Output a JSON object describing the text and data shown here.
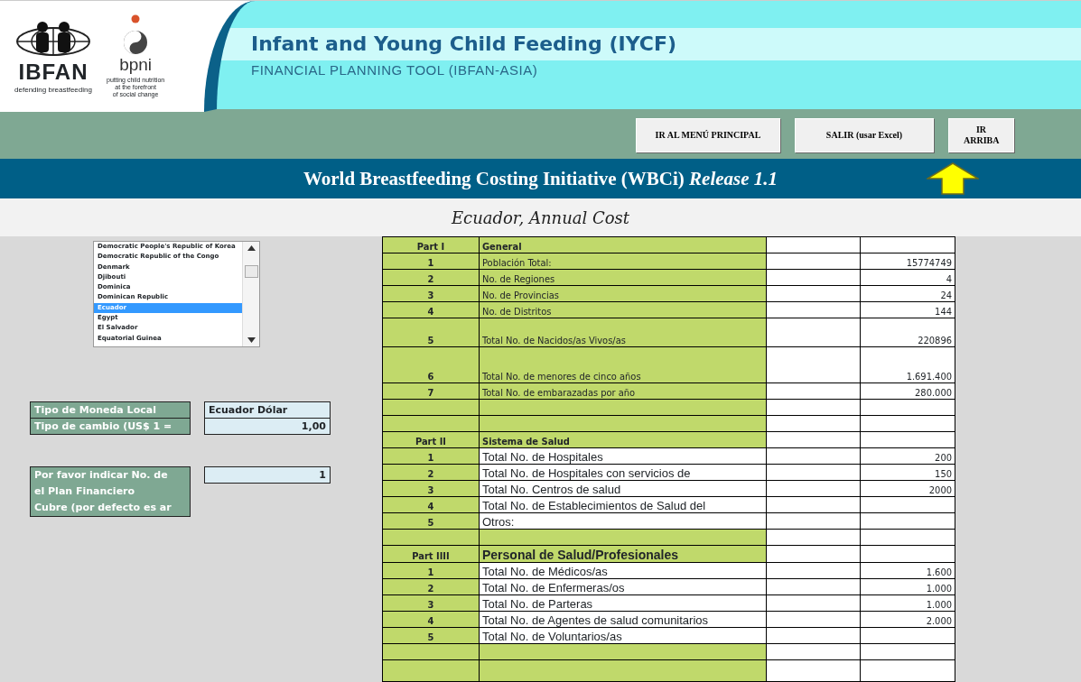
{
  "header": {
    "ibfan_logo": {
      "name": "IBFAN",
      "tagline": "defending breastfeeding"
    },
    "bpni_logo": {
      "name": "bpni",
      "tagline": [
        "putting child nutrition",
        "at the forefront",
        "of social change"
      ]
    },
    "title": "Infant and Young Child Feeding (IYCF)",
    "subtitle": "FINANCIAL PLANNING TOOL (IBFAN-ASIA)"
  },
  "buttons": [
    "IR AL MENÚ PRINCIPAL",
    "SALIR (usar Excel)",
    "IR ARRIBA"
  ],
  "banner": {
    "title": "World Breastfeeding Costing Initiative (WBCi) *Release 1.1*"
  },
  "subtitle": "Ecuador, Annual Cost",
  "country_list": [
    {
      "label": "Democratic People's Republic of Korea",
      "selected": false
    },
    {
      "label": "Democratic Republic of the Congo",
      "selected": false
    },
    {
      "label": "Denmark",
      "selected": false
    },
    {
      "label": "Djibouti",
      "selected": false
    },
    {
      "label": "Dominica",
      "selected": false
    },
    {
      "label": "Dominican Republic",
      "selected": false
    },
    {
      "label": "Ecuador",
      "selected": true
    },
    {
      "label": "Egypt",
      "selected": false
    },
    {
      "label": "El Salvador",
      "selected": false
    },
    {
      "label": "Equatorial Guinea",
      "selected": false
    }
  ],
  "currency": [
    {
      "label": "Tipo de Moneda Local",
      "value": "Ecuador Dólar"
    },
    {
      "label": "Tipo de cambio (US$ 1 =",
      "value": "1,00"
    }
  ],
  "plan_years": {
    "label": [
      "Por favor indicar No. de",
      "el Plan Financiero",
      "Cubre (por defecto es ar"
    ],
    "value": "1"
  },
  "table": {
    "rows": [
      {
        "kind": "heading",
        "number": "Part I",
        "label": "General"
      },
      {
        "kind": "item",
        "number": "1",
        "label": "Población Total:",
        "value": "15774749"
      },
      {
        "kind": "item",
        "number": "2",
        "label": "No. de Regiones",
        "value": "4"
      },
      {
        "kind": "item",
        "number": "3",
        "label": "No. de Provincias",
        "value": "24"
      },
      {
        "kind": "item",
        "number": "4",
        "label": "No. de Distritos",
        "value": "144"
      },
      {
        "kind": "item",
        "number": "5",
        "label": "Total No. de Nacidos/as Vivos/as",
        "value": "220896"
      },
      {
        "kind": "item",
        "number": "6",
        "label": "Total No. de menores de cinco años",
        "value": "1.691.400"
      },
      {
        "kind": "item",
        "number": "7",
        "label": "Total No. de embarazadas por año",
        "value": "280.000"
      },
      {
        "kind": "blank"
      },
      {
        "kind": "blank"
      },
      {
        "kind": "heading",
        "number": "Part II",
        "label": "Sistema de Salud"
      },
      {
        "kind": "entry",
        "number": "1",
        "label": "Total No. de Hospitales",
        "value": "200"
      },
      {
        "kind": "entry",
        "number": "2",
        "label": "Total No. de Hospitales con servicios de",
        "value": "150"
      },
      {
        "kind": "entry",
        "number": "3",
        "label": "Total No. Centros de salud",
        "value": "2000"
      },
      {
        "kind": "entry",
        "number": "4",
        "label": "Total No. de Establecimientos de Salud del"
      },
      {
        "kind": "entry",
        "number": "5",
        "label": "Otros:"
      },
      {
        "kind": "blank"
      },
      {
        "kind": "heading-large",
        "number": "Part IIII",
        "label": "Personal de Salud/Profesionales"
      },
      {
        "kind": "entry",
        "number": "1",
        "label": "Total No. de Médicos/as",
        "value": "1.600"
      },
      {
        "kind": "entry",
        "number": "2",
        "label": "Total No. de Enfermeras/os",
        "value": "1.000"
      },
      {
        "kind": "entry",
        "number": "3",
        "label": "Total No. de Parteras",
        "value": "1.000"
      },
      {
        "kind": "entry",
        "number": "4",
        "label": "Total No. de Agentes de salud comunitarios",
        "value": "2.000"
      },
      {
        "kind": "entry",
        "number": "5",
        "label": "Total No. de Voluntarios/as"
      },
      {
        "kind": "blank"
      },
      {
        "kind": "blank"
      }
    ]
  }
}
